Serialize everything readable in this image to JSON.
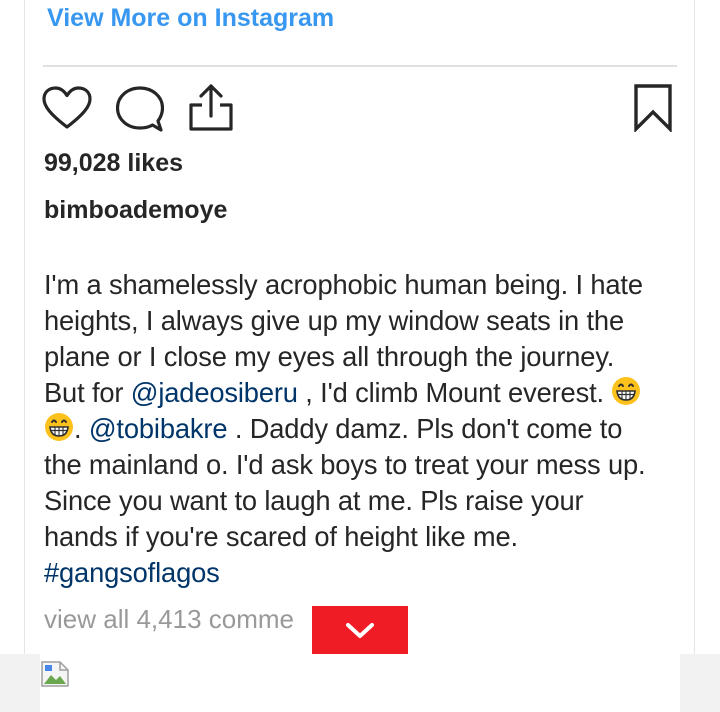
{
  "header": {
    "view_more_label": "View More on Instagram"
  },
  "actions": {
    "like_icon": "heart-icon",
    "comment_icon": "comment-bubble-icon",
    "share_icon": "share-upload-icon",
    "save_icon": "bookmark-icon"
  },
  "post": {
    "likes": "99,028 likes",
    "username": "bimboademoye",
    "caption": {
      "line1": "I'm a shamelessly acrophobic human being. I hate",
      "line2": "heights, I always give up my window seats in the",
      "line3": "plane or I close my eyes all through the journey.",
      "line4_before": "But for ",
      "mention1": "@jadeosiberu",
      "line4_after": " , I'd climb Mount everest. ",
      "line5_before": ". ",
      "mention2": "@tobibakre",
      "line5_after": " . Daddy damz. Pls don't come to",
      "line6": "the mainland o. I'd ask boys to treat your mess up.",
      "line7": "Since you want to laugh at me. Pls raise your",
      "line8": "hands if you're scared of height like me.",
      "hashtag": "#gangsoflagos"
    },
    "comments_link": "view all 4,413 comme",
    "emoji_name": "grinning-face-emoji"
  },
  "colors": {
    "link_blue": "#3897f0",
    "mention_blue": "#003569",
    "text": "#262626",
    "muted": "#999999",
    "scroll_button_red": "#ef1c25"
  }
}
